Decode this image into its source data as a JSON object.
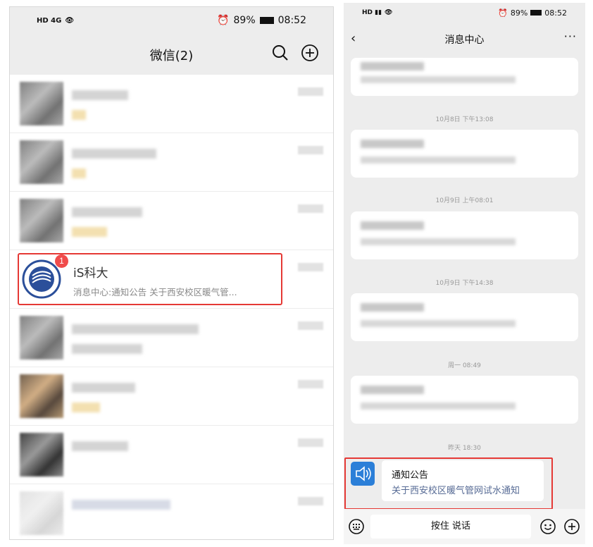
{
  "left": {
    "status": {
      "signal": "HD 4G",
      "battery": "89%",
      "time": "08:52"
    },
    "header": {
      "title": "微信(2)"
    },
    "chat": {
      "name": "iS科大",
      "preview": "消息中心:通知公告  关于西安校区暖气管...",
      "badge": "1"
    }
  },
  "right": {
    "status": {
      "battery": "89%",
      "time": "08:52"
    },
    "header": {
      "title": "消息中心",
      "more": "···"
    },
    "timestamps": [
      "10月8日 下午13:08",
      "10月9日 上午08:01",
      "10月9日 下午14:38",
      "周一 08:49",
      "昨天 18:30"
    ],
    "notice": {
      "title": "通知公告",
      "body": "关于西安校区暖气管网试水通知"
    },
    "input": {
      "hold_to_talk": "按住 说话"
    }
  },
  "colors": {
    "highlight": "#e53935",
    "badge": "#f04b4b",
    "link": "#576b95",
    "icon_bg": "#2b7fd8"
  }
}
